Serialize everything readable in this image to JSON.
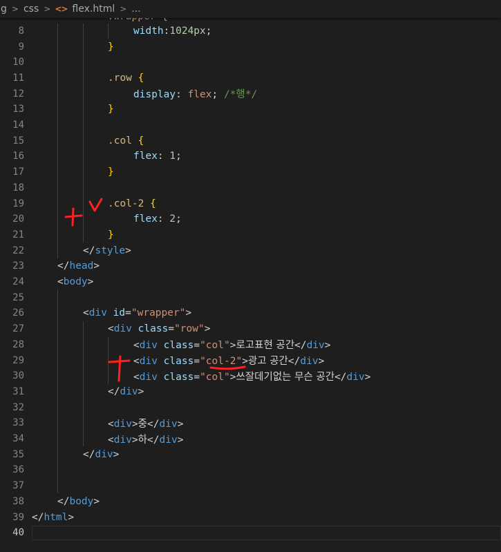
{
  "breadcrumb": {
    "items": [
      "g",
      "css",
      "flex.html",
      "..."
    ],
    "file_icon": "<>"
  },
  "editor": {
    "partial_top_line": ".wrapper {",
    "lines": [
      {
        "n": "8",
        "tokens": [
          [
            "prop",
            "width"
          ],
          [
            "punc",
            ":"
          ],
          [
            "num",
            "1024px"
          ],
          [
            "punc",
            ";"
          ]
        ]
      },
      {
        "n": "9",
        "tokens": [
          [
            "brace",
            "}"
          ]
        ]
      },
      {
        "n": "10",
        "tokens": []
      },
      {
        "n": "11",
        "tokens": [
          [
            "sel",
            ".row"
          ],
          [
            "punc",
            " "
          ],
          [
            "brace",
            "{"
          ]
        ]
      },
      {
        "n": "12",
        "tokens": [
          [
            "prop",
            "display"
          ],
          [
            "punc",
            ": "
          ],
          [
            "kw",
            "flex"
          ],
          [
            "punc",
            "; "
          ],
          [
            "cmt",
            "/*행*/"
          ]
        ]
      },
      {
        "n": "13",
        "tokens": [
          [
            "brace",
            "}"
          ]
        ]
      },
      {
        "n": "14",
        "tokens": []
      },
      {
        "n": "15",
        "tokens": [
          [
            "sel",
            ".col"
          ],
          [
            "punc",
            " "
          ],
          [
            "brace",
            "{"
          ]
        ]
      },
      {
        "n": "16",
        "tokens": [
          [
            "prop",
            "flex"
          ],
          [
            "punc",
            ": "
          ],
          [
            "num",
            "1"
          ],
          [
            "punc",
            ";"
          ]
        ]
      },
      {
        "n": "17",
        "tokens": [
          [
            "brace",
            "}"
          ]
        ]
      },
      {
        "n": "18",
        "tokens": []
      },
      {
        "n": "19",
        "tokens": [
          [
            "sel",
            ".col-2"
          ],
          [
            "punc",
            " "
          ],
          [
            "brace",
            "{"
          ]
        ]
      },
      {
        "n": "20",
        "tokens": [
          [
            "prop",
            "flex"
          ],
          [
            "punc",
            ": "
          ],
          [
            "num",
            "2"
          ],
          [
            "punc",
            ";"
          ]
        ]
      },
      {
        "n": "21",
        "tokens": [
          [
            "brace",
            "}"
          ]
        ]
      },
      {
        "n": "22",
        "tokens": [
          [
            "punc",
            "</"
          ],
          [
            "tag",
            "style"
          ],
          [
            "punc",
            ">"
          ]
        ]
      },
      {
        "n": "23",
        "tokens": [
          [
            "punc",
            "</"
          ],
          [
            "tag",
            "head"
          ],
          [
            "punc",
            ">"
          ]
        ]
      },
      {
        "n": "24",
        "tokens": [
          [
            "punc",
            "<"
          ],
          [
            "tag",
            "body"
          ],
          [
            "punc",
            ">"
          ]
        ]
      },
      {
        "n": "25",
        "tokens": []
      },
      {
        "n": "26",
        "tokens": [
          [
            "punc",
            "<"
          ],
          [
            "tag",
            "div"
          ],
          [
            "punc",
            " "
          ],
          [
            "attr",
            "id"
          ],
          [
            "punc",
            "="
          ],
          [
            "str",
            "\"wrapper\""
          ],
          [
            "punc",
            ">"
          ]
        ]
      },
      {
        "n": "27",
        "tokens": [
          [
            "punc",
            "<"
          ],
          [
            "tag",
            "div"
          ],
          [
            "punc",
            " "
          ],
          [
            "attr",
            "class"
          ],
          [
            "punc",
            "="
          ],
          [
            "str",
            "\"row\""
          ],
          [
            "punc",
            ">"
          ]
        ]
      },
      {
        "n": "28",
        "tokens": [
          [
            "punc",
            "<"
          ],
          [
            "tag",
            "div"
          ],
          [
            "punc",
            " "
          ],
          [
            "attr",
            "class"
          ],
          [
            "punc",
            "="
          ],
          [
            "str",
            "\"col\""
          ],
          [
            "punc",
            ">"
          ],
          [
            "txt",
            "로고표현 공간"
          ],
          [
            "punc",
            "</"
          ],
          [
            "tag",
            "div"
          ],
          [
            "punc",
            ">"
          ]
        ]
      },
      {
        "n": "29",
        "tokens": [
          [
            "punc",
            "<"
          ],
          [
            "tag",
            "div"
          ],
          [
            "punc",
            " "
          ],
          [
            "attr",
            "class"
          ],
          [
            "punc",
            "="
          ],
          [
            "str",
            "\""
          ],
          [
            "str",
            "col-2"
          ],
          [
            "str",
            "\""
          ],
          [
            "punc",
            ">"
          ],
          [
            "txt",
            "광고 공간"
          ],
          [
            "punc",
            "</"
          ],
          [
            "tag",
            "div"
          ],
          [
            "punc",
            ">"
          ]
        ]
      },
      {
        "n": "30",
        "tokens": [
          [
            "punc",
            "<"
          ],
          [
            "tag",
            "div"
          ],
          [
            "punc",
            " "
          ],
          [
            "attr",
            "class"
          ],
          [
            "punc",
            "="
          ],
          [
            "str",
            "\"col\""
          ],
          [
            "punc",
            ">"
          ],
          [
            "txt",
            "쓰잘데기없는 무슨 공간"
          ],
          [
            "punc",
            "</"
          ],
          [
            "tag",
            "div"
          ],
          [
            "punc",
            ">"
          ]
        ]
      },
      {
        "n": "31",
        "tokens": [
          [
            "punc",
            "</"
          ],
          [
            "tag",
            "div"
          ],
          [
            "punc",
            ">"
          ]
        ]
      },
      {
        "n": "32",
        "tokens": []
      },
      {
        "n": "33",
        "tokens": [
          [
            "punc",
            "<"
          ],
          [
            "tag",
            "div"
          ],
          [
            "punc",
            ">"
          ],
          [
            "txt",
            "중"
          ],
          [
            "punc",
            "</"
          ],
          [
            "tag",
            "div"
          ],
          [
            "punc",
            ">"
          ]
        ]
      },
      {
        "n": "34",
        "tokens": [
          [
            "punc",
            "<"
          ],
          [
            "tag",
            "div"
          ],
          [
            "punc",
            ">"
          ],
          [
            "txt",
            "하"
          ],
          [
            "punc",
            "</"
          ],
          [
            "tag",
            "div"
          ],
          [
            "punc",
            ">"
          ]
        ]
      },
      {
        "n": "35",
        "tokens": [
          [
            "punc",
            "</"
          ],
          [
            "tag",
            "div"
          ],
          [
            "punc",
            ">"
          ]
        ]
      },
      {
        "n": "36",
        "tokens": []
      },
      {
        "n": "37",
        "tokens": []
      },
      {
        "n": "38",
        "tokens": [
          [
            "punc",
            "</"
          ],
          [
            "tag",
            "body"
          ],
          [
            "punc",
            ">"
          ]
        ]
      },
      {
        "n": "39",
        "tokens": [
          [
            "punc",
            "</"
          ],
          [
            "tag",
            "html"
          ],
          [
            "punc",
            ">"
          ]
        ]
      },
      {
        "n": "40",
        "tokens": []
      }
    ],
    "active_line": "40"
  },
  "colors": {
    "background": "#1e1e1e",
    "annotation": "#ff2020"
  }
}
